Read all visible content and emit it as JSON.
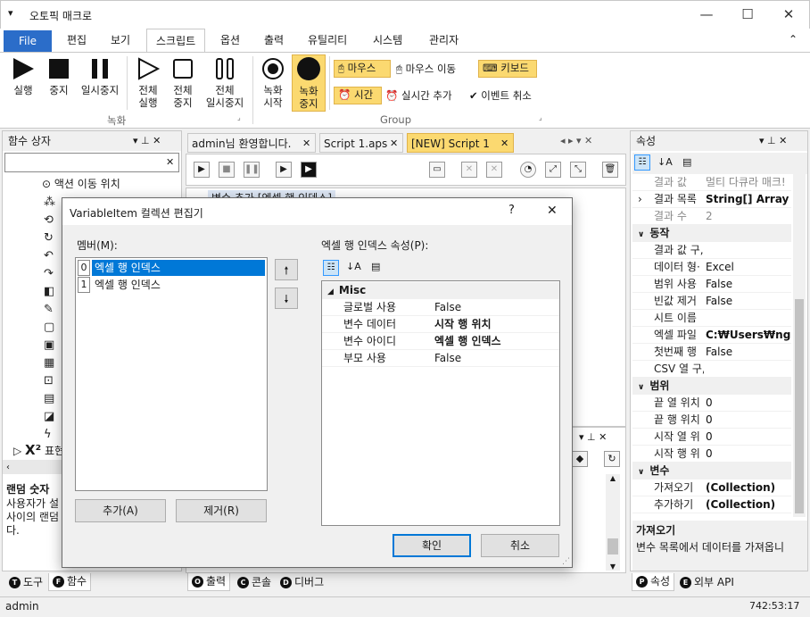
{
  "window": {
    "title": "오토픽 매크로",
    "menu_icon": "▾",
    "min": "—",
    "max": "☐",
    "close": "✕"
  },
  "menu": {
    "file": "File",
    "items": [
      "편집",
      "보기",
      "스크립트",
      "옵션",
      "출력",
      "유틸리티",
      "시스템",
      "관리자"
    ],
    "collapse": "⌃"
  },
  "ribbon": {
    "run": "실행",
    "stop": "중지",
    "pause": "일시중지",
    "all_run_1": "전체",
    "all_run_2": "실행",
    "all_stop_1": "전체",
    "all_stop_2": "중지",
    "all_pause_1": "전체",
    "all_pause_2": "일시중지",
    "rec_start_1": "녹화",
    "rec_start_2": "시작",
    "rec_stop_1": "녹화",
    "rec_stop_2": "중지",
    "mouse_click": "마우스",
    "mouse_move": "마우스 이동",
    "keyboard": "키보드",
    "time": "시간",
    "realtime_add": "실시간 추가",
    "event_cancel": "이벤트 취소",
    "group_record": "녹화",
    "group_group": "Group",
    "launcher": "⌟"
  },
  "left_panel": {
    "title": "함수 상자",
    "pin": "▾  ⊥  ✕",
    "search_clear": "✕",
    "tree": [
      "액션 이동 위치",
      "",
      "",
      "",
      "",
      "",
      "",
      "",
      "",
      "",
      "",
      "",
      "",
      "",
      "",
      "",
      ""
    ],
    "expr_label": "표현",
    "desc_title": "랜덤 숫자",
    "desc_line1": "사용자가 설",
    "desc_line2": "사이의 랜덤",
    "desc_line3": "다.",
    "tabs": [
      "도구",
      "함수"
    ],
    "tab_keys": [
      "T",
      "F"
    ]
  },
  "doc_tabs": [
    {
      "label": "admin님 환영합니다.",
      "close": "✕"
    },
    {
      "label": "Script 1.aps",
      "close": "✕"
    },
    {
      "label": "[NEW] Script 1",
      "close": "✕"
    }
  ],
  "doc_nav": "◂  ▸  ▾  ✕",
  "script_row": "변수 추가 [엑셀 행 인덱스]",
  "right_panel": {
    "title": "속성",
    "pin": "▾  ⊥  ✕",
    "rows": [
      {
        "k": "결과 값",
        "v": "멀티 다큐라 매크!",
        "dim": true
      },
      {
        "k": "결과 목록",
        "v": "String[] Array",
        "bold": true,
        "expand": "›"
      },
      {
        "k": "결과 수",
        "v": "2",
        "dim": true
      },
      {
        "cat": "동작"
      },
      {
        "k": "결과 값 구,",
        "v": ""
      },
      {
        "k": "데이터 형·",
        "v": "Excel"
      },
      {
        "k": "범위 사용",
        "v": "False"
      },
      {
        "k": "빈값 제거",
        "v": "False"
      },
      {
        "k": "시트 이름",
        "v": ""
      },
      {
        "k": "엑셀 파일",
        "v": "C:₩Users₩ngma",
        "bold": true
      },
      {
        "k": "첫번째 행",
        "v": "False"
      },
      {
        "k": "CSV 열 구,",
        "v": ""
      },
      {
        "cat": "범위"
      },
      {
        "k": "끝 열 위치",
        "v": "0"
      },
      {
        "k": "끝 행 위치",
        "v": "0"
      },
      {
        "k": "시작 열 위",
        "v": "0"
      },
      {
        "k": "시작 행 위",
        "v": "0"
      },
      {
        "cat": "변수"
      },
      {
        "k": "가져오기",
        "v": "(Collection)",
        "bold": true
      },
      {
        "k": "추가하기",
        "v": "(Collection)",
        "bold": true
      }
    ],
    "desc_title": "가져오기",
    "desc_text": "변수 목록에서 데이터를 가져옵니",
    "tabs": [
      "속성",
      "외부 API"
    ],
    "tab_keys": [
      "P",
      "E"
    ]
  },
  "bottom_tabs": [
    "출력",
    "콘솔",
    "디버그"
  ],
  "bottom_keys": [
    "O",
    "C",
    "D"
  ],
  "bottom_panel_ctrl": "▾  ⊥  ✕",
  "dialog": {
    "title": "VariableItem 컬렉션 편집기",
    "help": "?",
    "close": "✕",
    "members_label": "멤버(M):",
    "members": [
      {
        "idx": "0",
        "name": "엑셀 행 인덱스"
      },
      {
        "idx": "1",
        "name": "엑셀 행 인덱스"
      }
    ],
    "up": "🠕",
    "down": "🠗",
    "props_label": "엑셀 행 인덱스 속성(P):",
    "cat": "Misc",
    "props": [
      {
        "k": "글로벌 사용",
        "v": "False",
        "bold": false
      },
      {
        "k": "변수 데이터",
        "v": "시작 행 위치",
        "bold": true
      },
      {
        "k": "변수 아이디",
        "v": "엑셀 행 인덱스",
        "bold": true
      },
      {
        "k": "부모 사용",
        "v": "False",
        "bold": false
      }
    ],
    "add": "추가(A)",
    "remove": "제거(R)",
    "ok": "확인",
    "cancel": "취소"
  },
  "status": {
    "user": "admin",
    "coords": "742:53:17"
  }
}
